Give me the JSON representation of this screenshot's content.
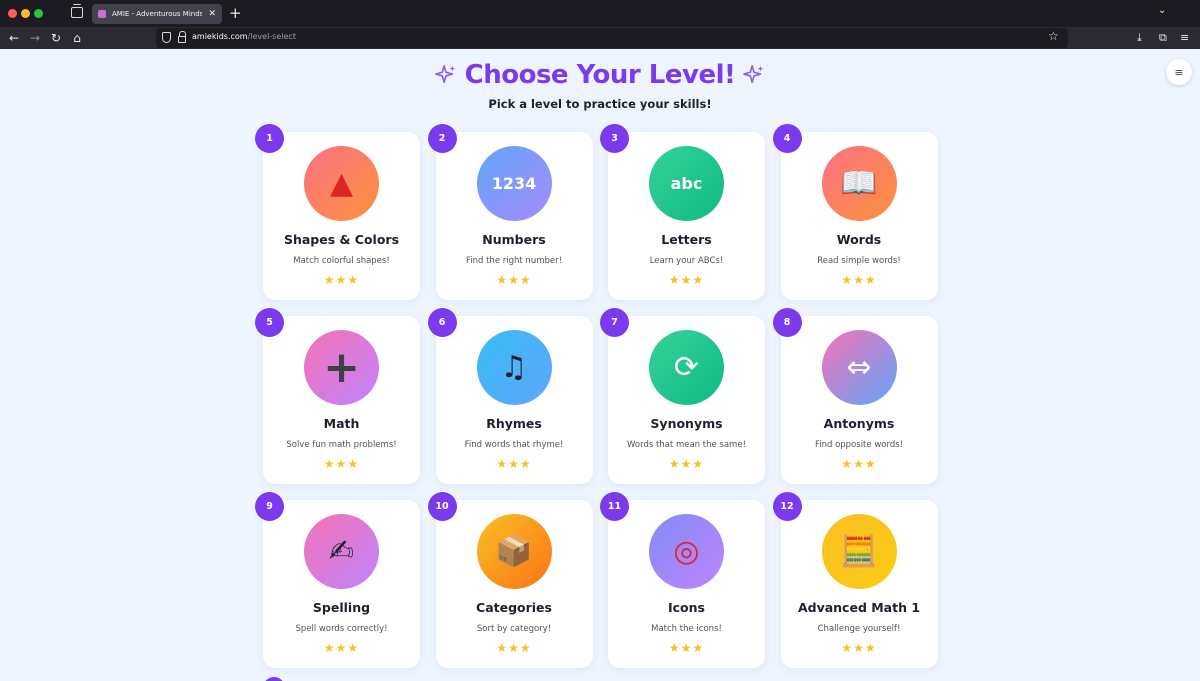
{
  "browser": {
    "tab_title": "AMIE - Adventurous Minds Imp",
    "tab_close": "✕",
    "new_tab": "+",
    "tab_list": "⌄",
    "back": "←",
    "forward": "→",
    "reload": "↻",
    "home": "⌂",
    "url_domain": "amiekids.com",
    "url_path": "/level-select",
    "bookmark": "☆",
    "download": "⤓",
    "extensions": "⧉",
    "more": "≡"
  },
  "page": {
    "title": "Choose Your Level!",
    "subtitle": "Pick a level to practice your skills!",
    "menu_icon": "≡",
    "accent": "#7c3aed",
    "star_color": "#fbbf24"
  },
  "levels": [
    {
      "num": "1",
      "title": "Shapes & Colors",
      "desc": "Match colorful shapes!",
      "stars": "★★★",
      "icon": "triangle-icon",
      "glyph": "▲",
      "glyph_color": "#dc2626",
      "bg": "linear-gradient(135deg,#fb7185,#fb923c)"
    },
    {
      "num": "2",
      "title": "Numbers",
      "desc": "Find the right number!",
      "stars": "★★★",
      "icon": "numbers-icon",
      "glyph": "1234",
      "glyph_color": "#ffffff",
      "bg": "linear-gradient(135deg,#60a5fa,#a78bfa)"
    },
    {
      "num": "3",
      "title": "Letters",
      "desc": "Learn your ABCs!",
      "stars": "★★★",
      "icon": "abc-icon",
      "glyph": "abc",
      "glyph_color": "#ffffff",
      "bg": "linear-gradient(135deg,#34d399,#10b981)"
    },
    {
      "num": "4",
      "title": "Words",
      "desc": "Read simple words!",
      "stars": "★★★",
      "icon": "book-icon",
      "glyph": "📖",
      "glyph_color": "#ffffff",
      "bg": "linear-gradient(135deg,#fb7185,#fb923c)"
    },
    {
      "num": "5",
      "title": "Math",
      "desc": "Solve fun math problems!",
      "stars": "★★★",
      "icon": "plus-icon",
      "glyph": "+",
      "glyph_color": "#3f3f46",
      "bg": "linear-gradient(135deg,#f472b6,#c084fc)"
    },
    {
      "num": "6",
      "title": "Rhymes",
      "desc": "Find words that rhyme!",
      "stars": "★★★",
      "icon": "music-note-icon",
      "glyph": "♫",
      "glyph_color": "#1f1f2e",
      "bg": "linear-gradient(135deg,#38bdf8,#60a5fa)"
    },
    {
      "num": "7",
      "title": "Synonyms",
      "desc": "Words that mean the same!",
      "stars": "★★★",
      "icon": "repeat-icon",
      "glyph": "⟳",
      "glyph_color": "#ffffff",
      "bg": "linear-gradient(135deg,#34d399,#10b981)"
    },
    {
      "num": "8",
      "title": "Antonyms",
      "desc": "Find opposite words!",
      "stars": "★★★",
      "icon": "left-right-arrow-icon",
      "glyph": "⇔",
      "glyph_color": "#ffffff",
      "bg": "linear-gradient(135deg,#f472b6,#60a5fa)"
    },
    {
      "num": "9",
      "title": "Spelling",
      "desc": "Spell words correctly!",
      "stars": "★★★",
      "icon": "writing-hand-icon",
      "glyph": "✍",
      "glyph_color": "#1f1f2e",
      "bg": "linear-gradient(135deg,#f472b6,#c084fc)"
    },
    {
      "num": "10",
      "title": "Categories",
      "desc": "Sort by category!",
      "stars": "★★★",
      "icon": "package-icon",
      "glyph": "📦",
      "glyph_color": "#ffffff",
      "bg": "linear-gradient(135deg,#fbbf24,#f97316)"
    },
    {
      "num": "11",
      "title": "Icons",
      "desc": "Match the icons!",
      "stars": "★★★",
      "icon": "target-icon",
      "glyph": "◎",
      "glyph_color": "#dc2626",
      "bg": "linear-gradient(135deg,#818cf8,#c084fc)"
    },
    {
      "num": "12",
      "title": "Advanced Math 1",
      "desc": "Challenge yourself!",
      "stars": "★★★",
      "icon": "abacus-icon",
      "glyph": "🧮",
      "glyph_color": "#ffffff",
      "bg": "linear-gradient(135deg,#fbbf24,#facc15)"
    }
  ]
}
